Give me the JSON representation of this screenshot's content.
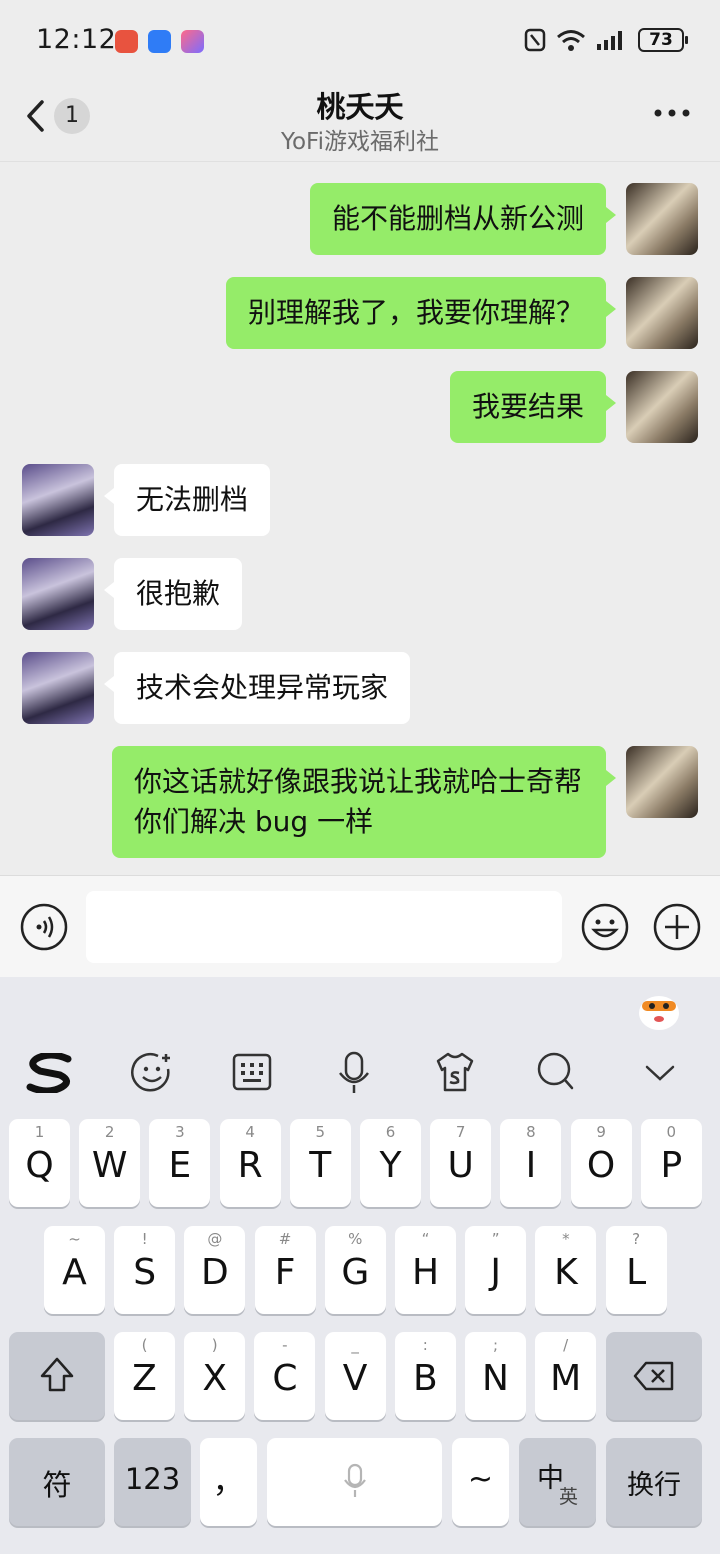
{
  "status_bar": {
    "time": "12:12",
    "battery": "73"
  },
  "nav": {
    "back_count": "1",
    "title": "桃夭夭",
    "subtitle": "YoFi游戏福利社"
  },
  "messages": [
    {
      "from": "me",
      "text": "能不能删档从新公测"
    },
    {
      "from": "me",
      "text": "别理解我了，我要你理解？"
    },
    {
      "from": "me",
      "text": "我要结果"
    },
    {
      "from": "them",
      "text": "无法删档"
    },
    {
      "from": "them",
      "text": "很抱歉"
    },
    {
      "from": "them",
      "text": "技术会处理异常玩家"
    },
    {
      "from": "me",
      "text": "你这话就好像跟我说让我就哈士奇帮你们解决 bug 一样"
    }
  ],
  "input": {
    "value": ""
  },
  "keyboard": {
    "row1": [
      {
        "k": "Q",
        "s": "1"
      },
      {
        "k": "W",
        "s": "2"
      },
      {
        "k": "E",
        "s": "3"
      },
      {
        "k": "R",
        "s": "4"
      },
      {
        "k": "T",
        "s": "5"
      },
      {
        "k": "Y",
        "s": "6"
      },
      {
        "k": "U",
        "s": "7"
      },
      {
        "k": "I",
        "s": "8"
      },
      {
        "k": "O",
        "s": "9"
      },
      {
        "k": "P",
        "s": "0"
      }
    ],
    "row2": [
      {
        "k": "A",
        "s": "~"
      },
      {
        "k": "S",
        "s": "!"
      },
      {
        "k": "D",
        "s": "@"
      },
      {
        "k": "F",
        "s": "#"
      },
      {
        "k": "G",
        "s": "%"
      },
      {
        "k": "H",
        "s": "“"
      },
      {
        "k": "J",
        "s": "”"
      },
      {
        "k": "K",
        "s": "*"
      },
      {
        "k": "L",
        "s": "?"
      }
    ],
    "row3": [
      {
        "k": "Z",
        "s": "("
      },
      {
        "k": "X",
        "s": ")"
      },
      {
        "k": "C",
        "s": "-"
      },
      {
        "k": "V",
        "s": "_"
      },
      {
        "k": "B",
        "s": ":"
      },
      {
        "k": "N",
        "s": ";"
      },
      {
        "k": "M",
        "s": "/"
      }
    ],
    "symbols_label": "符",
    "numbers_label": "123",
    "comma_label": "，",
    "tilde_label": "~",
    "lang_main": "中",
    "lang_sub": "英",
    "enter_label": "换行"
  },
  "colors": {
    "my_bubble": "#95ec69",
    "their_bubble": "#ffffff",
    "chat_bg": "#ededed"
  },
  "icons": [
    "back-chevron-icon",
    "more-icon",
    "voice-icon",
    "emoji-icon",
    "plus-icon",
    "sogou-logo-icon",
    "keyboard-emoji-icon",
    "keyboard-layout-icon",
    "mic-icon",
    "skin-icon",
    "search-icon",
    "collapse-icon",
    "shift-icon",
    "backspace-icon"
  ]
}
